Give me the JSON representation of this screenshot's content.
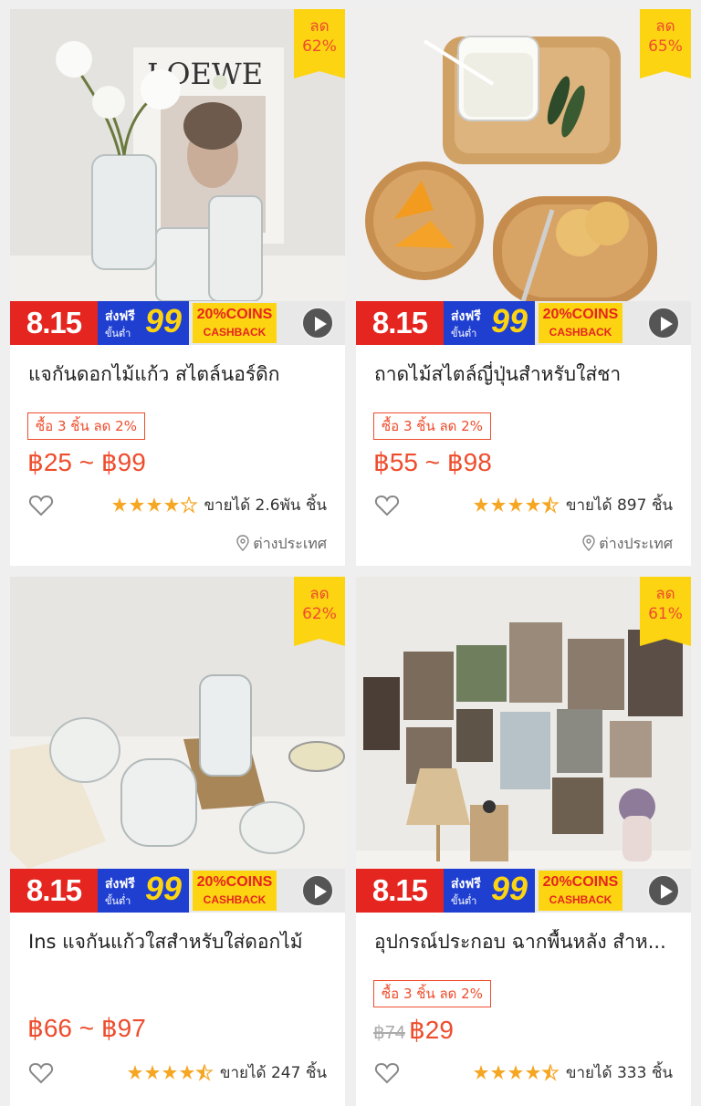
{
  "colors": {
    "accent": "#ee4d2d",
    "badge": "#fcd412",
    "star": "#f5a623"
  },
  "promo": {
    "date": "8.15",
    "ship_line1": "ส่งฟรี",
    "ship_line2": "ขั้นต่ำ",
    "ship_value": "99",
    "cash_line1": "20%COINS",
    "cash_line2": "CASHBACK"
  },
  "products": [
    {
      "discount_label": "ลด",
      "discount_pct": "62%",
      "title": "แจกันดอกไม้แก้ว สไตล์นอร์ดิก",
      "tag": "ซื้อ 3 ชิ้น ลด 2%",
      "price": "฿25 ~ ฿99",
      "rating": 4,
      "sold": "ขายได้ 2.6พัน ชิ้น",
      "location": "ต่างประเทศ",
      "photo_text": "LOEWE"
    },
    {
      "discount_label": "ลด",
      "discount_pct": "65%",
      "title": "ถาดไม้สไตล์ญี่ปุ่นสำหรับใส่ชา",
      "tag": "ซื้อ 3 ชิ้น ลด 2%",
      "price": "฿55 ~ ฿98",
      "rating": 4.5,
      "sold": "ขายได้ 897 ชิ้น",
      "location": "ต่างประเทศ"
    },
    {
      "discount_label": "ลด",
      "discount_pct": "62%",
      "title": "Ins แจกันแก้วใสสำหรับใส่ดอกไม้",
      "price": "฿66 ~ ฿97",
      "rating": 4.5,
      "sold": "ขายได้ 247 ชิ้น"
    },
    {
      "discount_label": "ลด",
      "discount_pct": "61%",
      "title": "อุปกรณ์ประกอบ ฉากพื้นหลัง สำห...",
      "tag": "ซื้อ 3 ชิ้น ลด 2%",
      "old_price": "฿74",
      "price": "฿29",
      "rating": 4.5,
      "sold": "ขายได้ 333 ชิ้น"
    }
  ]
}
